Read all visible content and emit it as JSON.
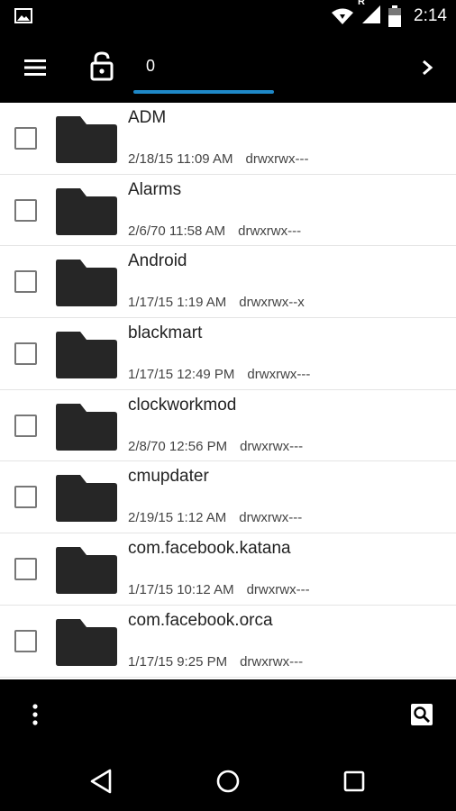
{
  "status_bar": {
    "time": "2:14",
    "icons": [
      "image-icon",
      "wifi-icon",
      "signal-icon",
      "battery-icon"
    ],
    "roaming_label": "R"
  },
  "toolbar": {
    "icons": [
      "menu-icon",
      "lock-open-icon",
      "chevron-right-icon"
    ],
    "active_tab": "0",
    "accent_color": "#1e88c8"
  },
  "files": [
    {
      "name": "ADM",
      "date": "2/18/15 11:09 AM",
      "permissions": "drwxrwx---"
    },
    {
      "name": "Alarms",
      "date": "2/6/70 11:58 AM",
      "permissions": "drwxrwx---"
    },
    {
      "name": "Android",
      "date": "1/17/15 1:19 AM",
      "permissions": "drwxrwx--x"
    },
    {
      "name": "blackmart",
      "date": "1/17/15 12:49 PM",
      "permissions": "drwxrwx---"
    },
    {
      "name": "clockworkmod",
      "date": "2/8/70 12:56 PM",
      "permissions": "drwxrwx---"
    },
    {
      "name": "cmupdater",
      "date": "2/19/15 1:12 AM",
      "permissions": "drwxrwx---"
    },
    {
      "name": "com.facebook.katana",
      "date": "1/17/15 10:12 AM",
      "permissions": "drwxrwx---"
    },
    {
      "name": "com.facebook.orca",
      "date": "1/17/15 9:25 PM",
      "permissions": "drwxrwx---"
    }
  ],
  "bottom_bar": {
    "icons": [
      "more-vert-icon",
      "search-icon"
    ]
  },
  "nav_bar": {
    "icons": [
      "back-icon",
      "home-icon",
      "recents-icon"
    ]
  }
}
